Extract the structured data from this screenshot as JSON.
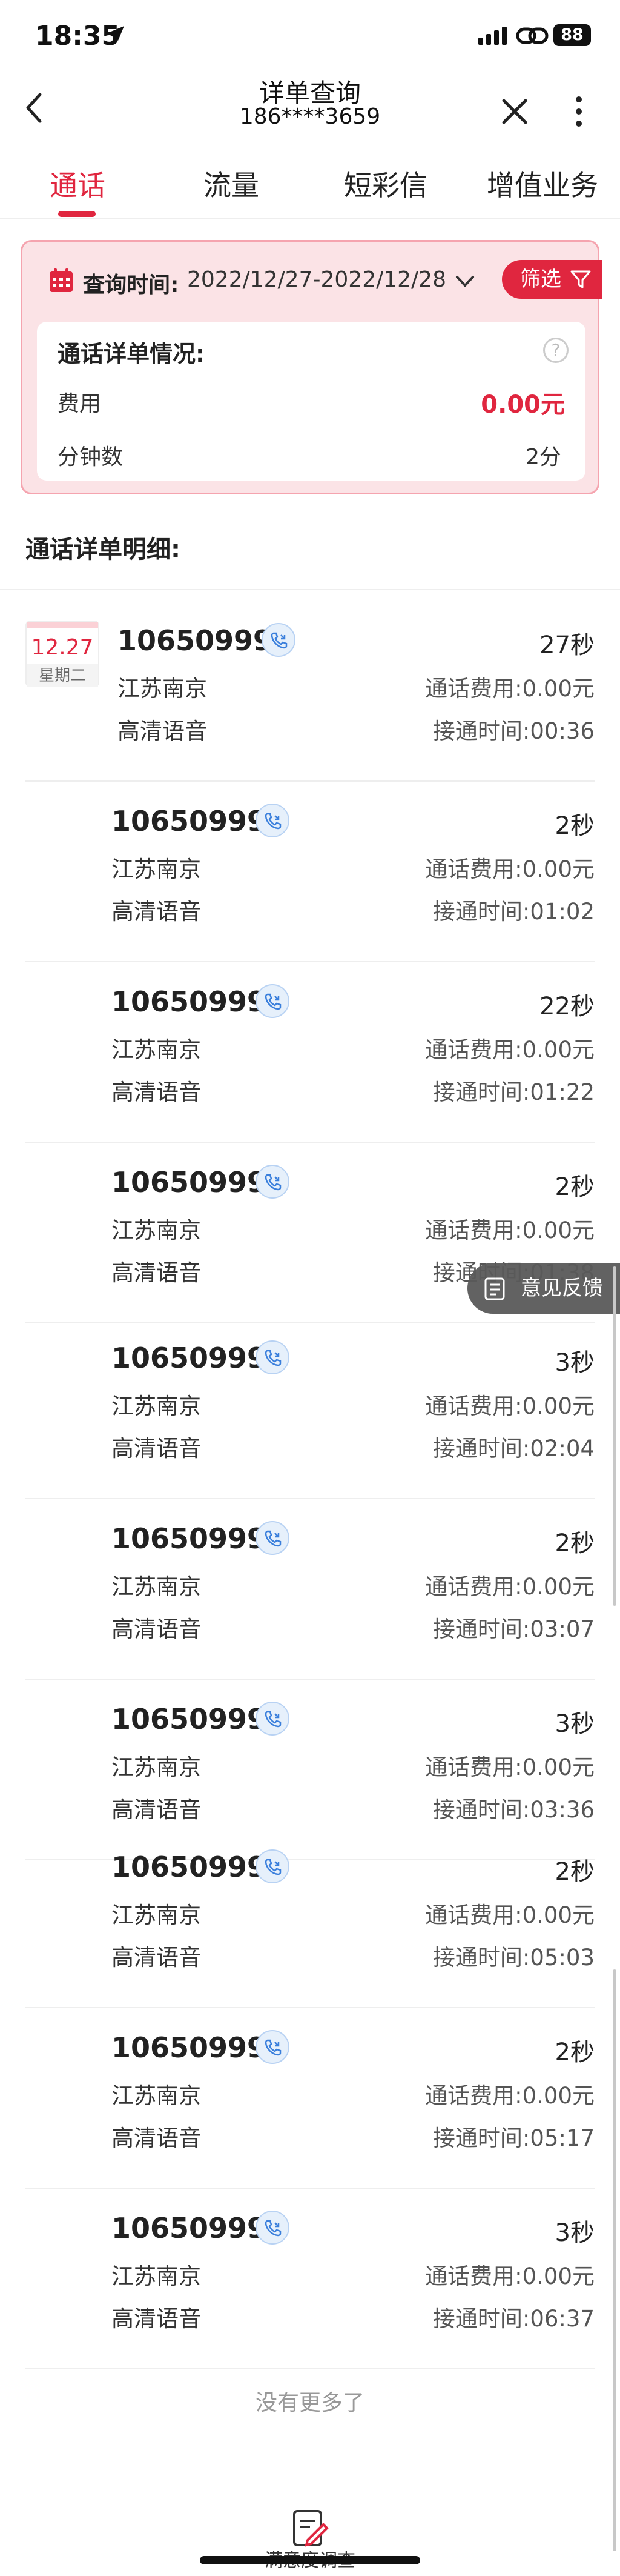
{
  "status_bar": {
    "time": "18:35",
    "battery": "88"
  },
  "header": {
    "title": "详单查询",
    "subtitle": "186****3659"
  },
  "tabs": [
    {
      "label": "通话",
      "active": true
    },
    {
      "label": "流量",
      "active": false
    },
    {
      "label": "短彩信",
      "active": false
    },
    {
      "label": "增值业务",
      "active": false
    }
  ],
  "summary": {
    "query_label": "查询时间:",
    "query_range": "2022/12/27-2022/12/28",
    "filter_label": "筛选",
    "title": "通话详单情况:",
    "help": "?",
    "fee_label": "费用",
    "fee_value": "0.00元",
    "minutes_label": "分钟数",
    "minutes_value": "2分"
  },
  "detail_title": "通话详单明细:",
  "date_badge": {
    "date": "12.27",
    "weekday": "星期二"
  },
  "records": [
    {
      "number": "10650999",
      "duration": "27秒",
      "location": "江苏南京",
      "fee": "通话费用:0.00元",
      "type": "高清语音",
      "connect": "接通时间:00:36"
    },
    {
      "number": "10650999",
      "duration": "2秒",
      "location": "江苏南京",
      "fee": "通话费用:0.00元",
      "type": "高清语音",
      "connect": "接通时间:01:02"
    },
    {
      "number": "10650999",
      "duration": "22秒",
      "location": "江苏南京",
      "fee": "通话费用:0.00元",
      "type": "高清语音",
      "connect": "接通时间:01:22"
    },
    {
      "number": "10650999",
      "duration": "2秒",
      "location": "江苏南京",
      "fee": "通话费用:0.00元",
      "type": "高清语音",
      "connect": "接通时间:01:38"
    },
    {
      "number": "10650999",
      "duration": "3秒",
      "location": "江苏南京",
      "fee": "通话费用:0.00元",
      "type": "高清语音",
      "connect": "接通时间:02:04"
    },
    {
      "number": "10650999",
      "duration": "2秒",
      "location": "江苏南京",
      "fee": "通话费用:0.00元",
      "type": "高清语音",
      "connect": "接通时间:03:07"
    },
    {
      "number": "10650999",
      "duration": "3秒",
      "location": "江苏南京",
      "fee": "通话费用:0.00元",
      "type": "高清语音",
      "connect": "接通时间:03:36"
    },
    {
      "number": "10650999",
      "duration": "2秒",
      "location": "江苏南京",
      "fee": "通话费用:0.00元",
      "type": "高清语音",
      "connect": "接通时间:05:03"
    },
    {
      "number": "10650999",
      "duration": "2秒",
      "location": "江苏南京",
      "fee": "通话费用:0.00元",
      "type": "高清语音",
      "connect": "接通时间:05:17"
    },
    {
      "number": "10650999",
      "duration": "3秒",
      "location": "江苏南京",
      "fee": "通话费用:0.00元",
      "type": "高清语音",
      "connect": "接通时间:06:37"
    }
  ],
  "feedback_label": "意见反馈",
  "no_more": "没有更多了",
  "bottom_label": "满意度调查",
  "colors": {
    "accent": "#e0263f",
    "card_bg": "#fbe3e6",
    "phone_blue": "#3a7fdc"
  }
}
